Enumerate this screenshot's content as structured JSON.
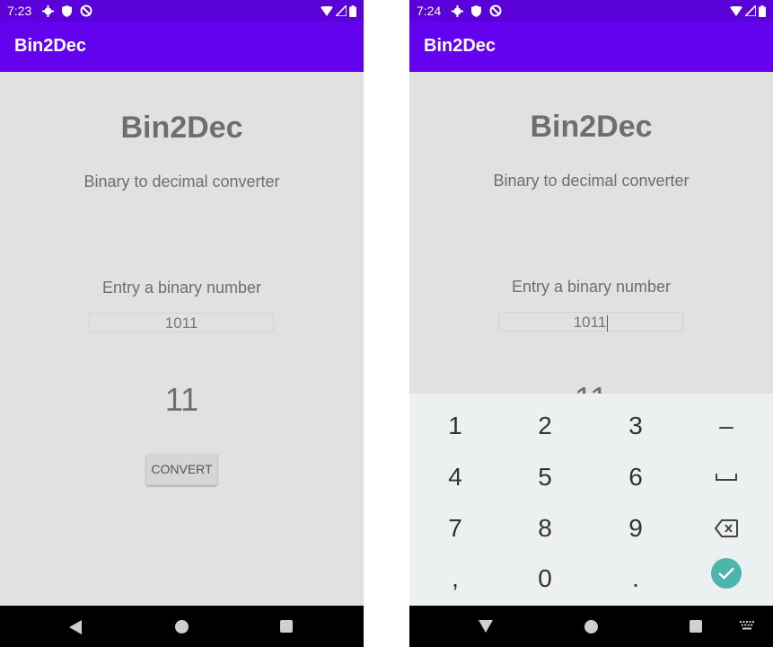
{
  "left": {
    "status": {
      "time": "7:23"
    },
    "appbar": {
      "title": "Bin2Dec"
    },
    "main": {
      "title": "Bin2Dec",
      "subtitle": "Binary to decimal converter",
      "prompt": "Entry a binary number",
      "input_value": "1011",
      "result": "11",
      "convert_label": "CONVERT"
    }
  },
  "right": {
    "status": {
      "time": "7:24"
    },
    "appbar": {
      "title": "Bin2Dec"
    },
    "main": {
      "title": "Bin2Dec",
      "subtitle": "Binary to decimal converter",
      "prompt": "Entry a binary number",
      "input_value": "1011",
      "result": "11"
    },
    "keyboard": {
      "rows": [
        [
          "1",
          "2",
          "3",
          "–"
        ],
        [
          "4",
          "5",
          "6",
          "space"
        ],
        [
          "7",
          "8",
          "9",
          "backspace"
        ],
        [
          ",",
          "0",
          ".",
          "done"
        ]
      ]
    }
  },
  "colors": {
    "status_bar": "#5a00d8",
    "app_bar": "#6202ee",
    "content_bg": "#e1e1e1",
    "keyboard_bg": "#ecf0f1",
    "done_key": "#4db6ac"
  },
  "icons": [
    "settings-icon",
    "shield-icon",
    "vpn-icon",
    "wifi-icon",
    "signal-icon",
    "battery-icon",
    "back-icon",
    "home-icon",
    "recents-icon",
    "keyboard-hide-icon",
    "keyboard-switch-icon",
    "space-icon",
    "backspace-icon",
    "check-icon"
  ]
}
